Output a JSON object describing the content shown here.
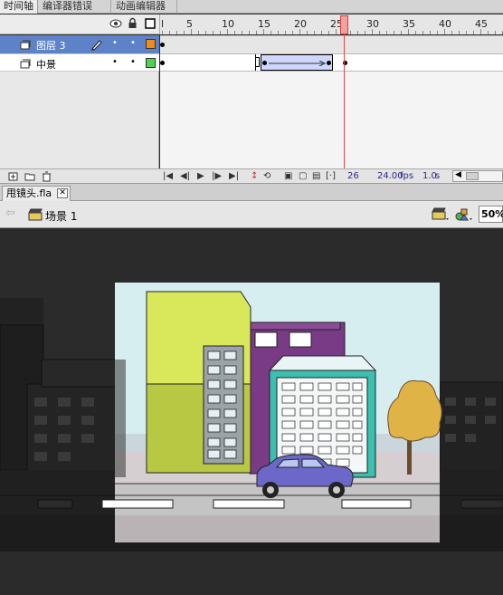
{
  "panel_tabs": [
    {
      "label": "时间轴"
    },
    {
      "label": "编译器错误"
    },
    {
      "label": "动画编辑器"
    }
  ],
  "ruler": {
    "start_marker": "l",
    "numbers": [
      "5",
      "10",
      "15",
      "20",
      "25",
      "30",
      "35",
      "40",
      "45"
    ],
    "current_frame_label": "25"
  },
  "layers": [
    {
      "name": "图层 3",
      "color": "#f08a1e",
      "selected": true
    },
    {
      "name": "中景",
      "color": "#4fd24f",
      "selected": false
    }
  ],
  "status": {
    "current_frame": "26",
    "frame_rate": "24.00",
    "fps_unit": "fps",
    "elapsed": "1.0",
    "elapsed_unit": "s"
  },
  "document": {
    "tab_label": "甩镜头.fla",
    "close_symbol": "✕"
  },
  "edit_bar": {
    "scene_label": "场景 1",
    "zoom": "50%"
  },
  "colors": {
    "selected_layer": "#5d82c8",
    "playhead": "#e04848",
    "stage_dim": "#2b2b2b",
    "tween_fill": "#cfd6ff"
  },
  "icons": [
    "eye-icon",
    "lock-icon",
    "outline-icon",
    "layer-icon",
    "pencil-icon",
    "new-layer-icon",
    "new-folder-icon",
    "trash-icon",
    "first-frame-icon",
    "step-back-icon",
    "play-icon",
    "step-forward-icon",
    "last-frame-icon",
    "loop-icon",
    "onion-skin-icon",
    "back-arrow-icon",
    "scene-icon",
    "edit-scene-icon",
    "edit-symbol-icon"
  ]
}
